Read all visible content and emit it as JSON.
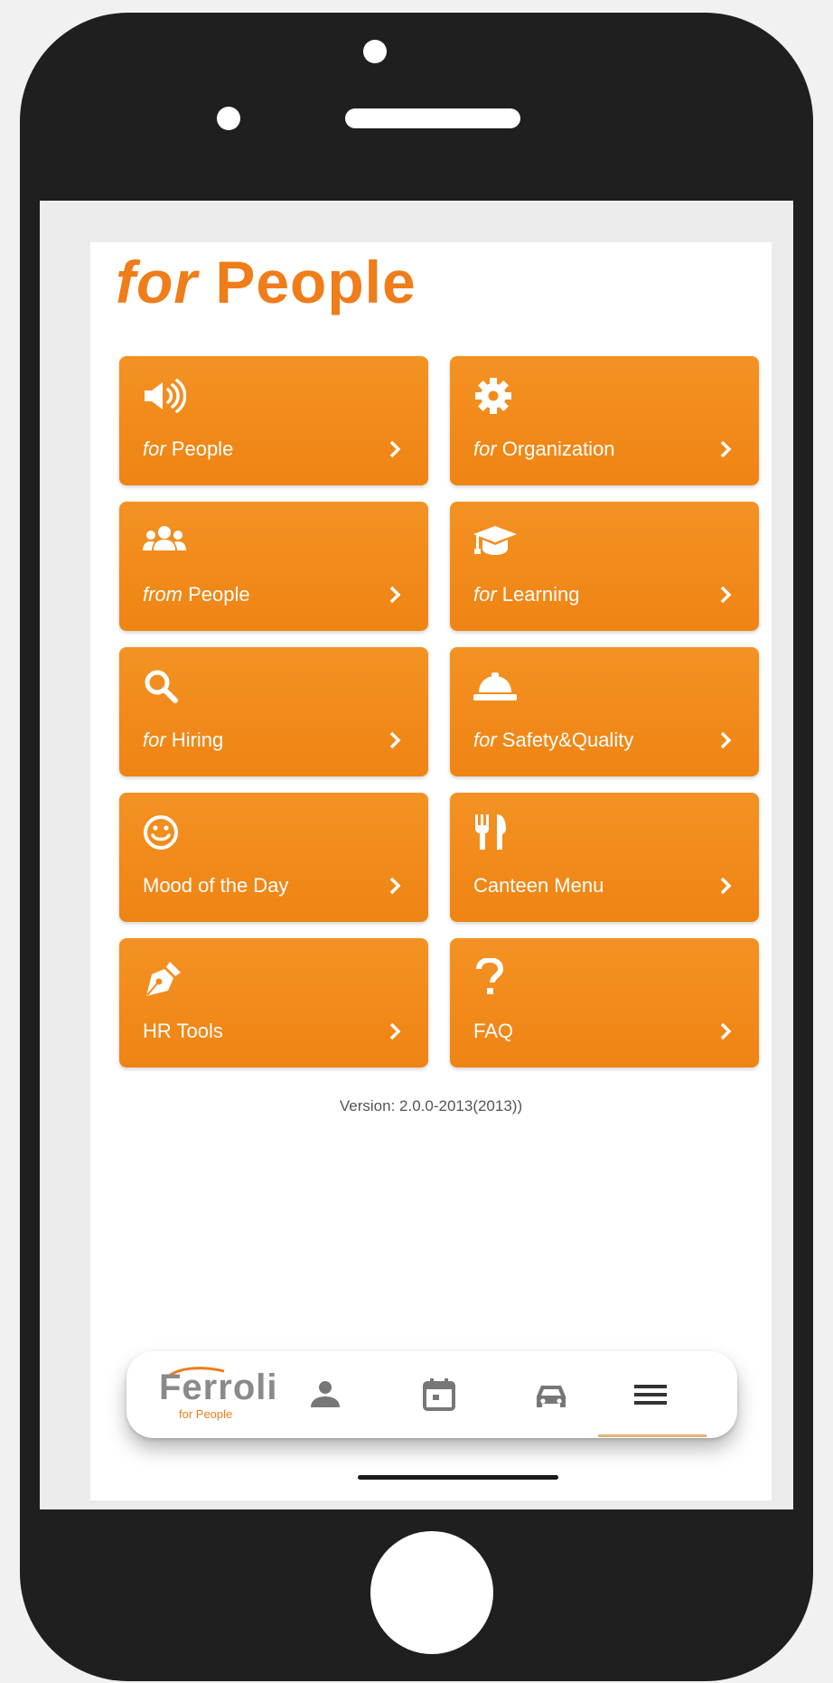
{
  "header": {
    "title_italic": "for",
    "title_rest": " People"
  },
  "tiles": [
    {
      "icon": "megaphone-icon",
      "italic": "for",
      "text": " People"
    },
    {
      "icon": "gear-icon",
      "italic": "for",
      "text": " Organization"
    },
    {
      "icon": "group-icon",
      "italic": "from",
      "text": " People"
    },
    {
      "icon": "graduation-cap-icon",
      "italic": "for",
      "text": " Learning"
    },
    {
      "icon": "search-icon",
      "italic": "for",
      "text": " Hiring"
    },
    {
      "icon": "hard-hat-icon",
      "italic": "for",
      "text": " Safety&Quality"
    },
    {
      "icon": "smiley-icon",
      "italic": "",
      "text": "Mood of the Day"
    },
    {
      "icon": "cutlery-icon",
      "italic": "",
      "text": "Canteen Menu"
    },
    {
      "icon": "pen-icon",
      "italic": "",
      "text": "HR Tools"
    },
    {
      "icon": "question-icon",
      "italic": "",
      "text": "FAQ"
    }
  ],
  "version": "Version: 2.0.0-2013(2013))",
  "bottom_nav": {
    "brand": "Ferroli",
    "brand_sub": "for People",
    "items": [
      "person-icon",
      "calendar-icon",
      "car-icon",
      "menu-icon"
    ],
    "active": "menu-icon"
  },
  "colors": {
    "accent": "#ef7d1a",
    "tile": "#f18b1c",
    "phone_frame": "#1f1f1f"
  }
}
